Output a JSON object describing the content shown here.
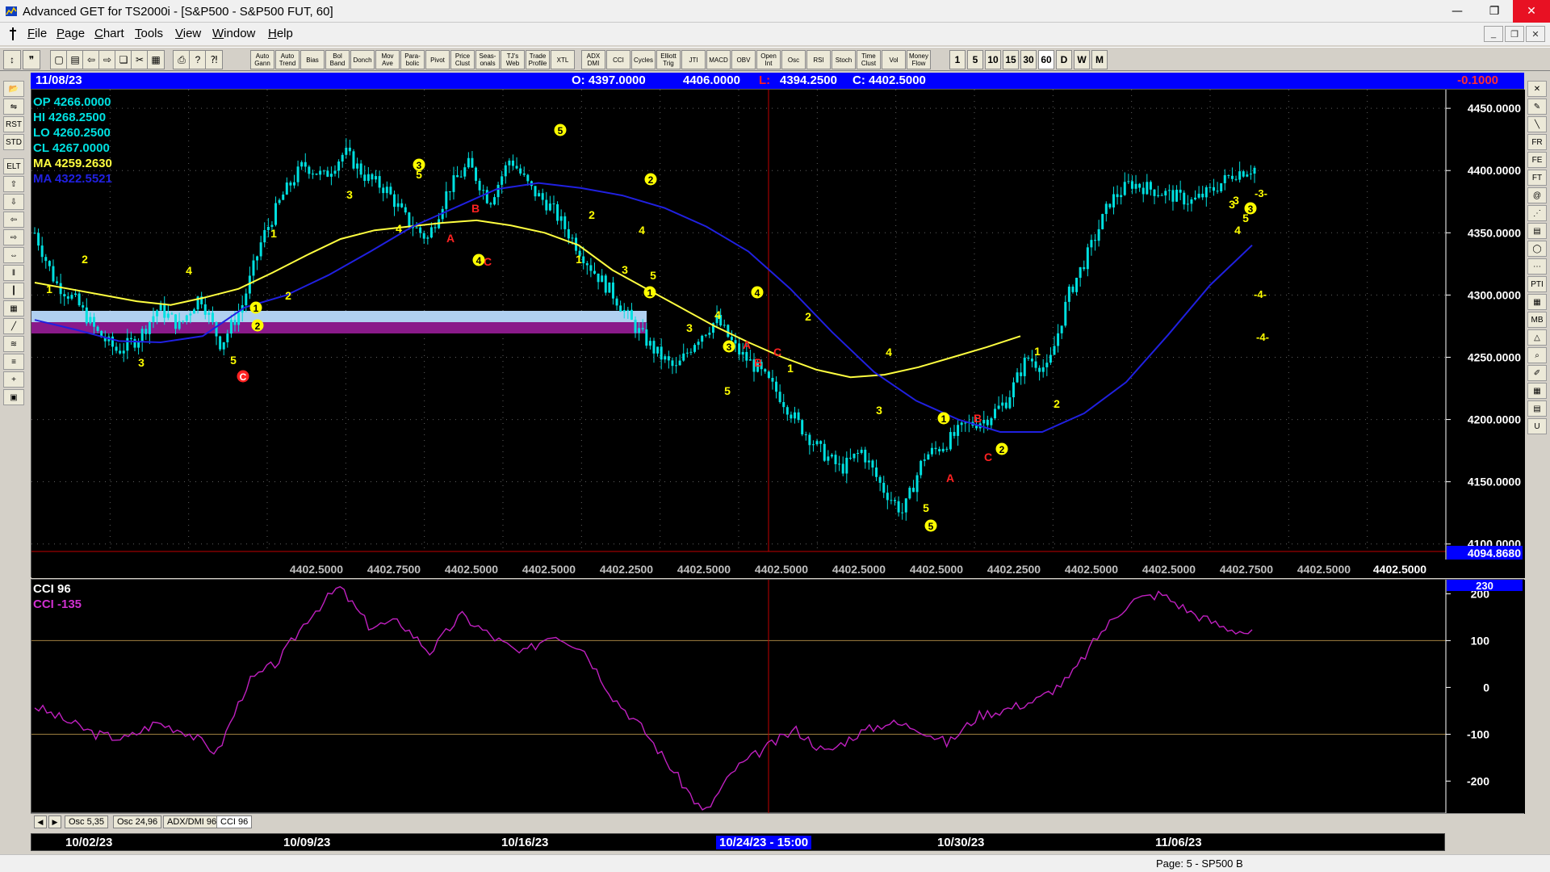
{
  "window": {
    "title": "Advanced GET for TS2000i - [S&P500 - S&P500 FUT, 60]",
    "controls": [
      "—",
      "❐",
      "✕"
    ]
  },
  "menu": [
    "File",
    "Page",
    "Chart",
    "Tools",
    "View",
    "Window",
    "Help"
  ],
  "toolbar": {
    "study_buttons": [
      "Auto Gann",
      "Auto Trend",
      "Bias",
      "Bol Band",
      "Donch",
      "Mov Ave",
      "Para-bolic",
      "Pivot",
      "Price Clust",
      "Seas-onals",
      "TJ's Web",
      "Trade Profile",
      "XTL",
      "ADX DMI",
      "CCI",
      "Cycles",
      "Elliott Trig",
      "JTI",
      "MACD",
      "OBV",
      "Open Int",
      "Osc",
      "RSI",
      "Stoch",
      "Time Clust",
      "Vol",
      "Money Flow"
    ],
    "periods": [
      "1",
      "5",
      "10",
      "15",
      "30",
      "60",
      "D",
      "W",
      "M"
    ],
    "active_period": "60"
  },
  "header": {
    "date": "11/08/23",
    "open": "O: 4397.0000",
    "high": "4406.0000",
    "low_prefix": "L:",
    "low": "4394.2500",
    "close": "C:  4402.5000",
    "change": "-0.1000"
  },
  "info": {
    "op": "OP  4266.0000",
    "hi": "HI   4268.2500",
    "lo": "LO  4260.2500",
    "cl": "CL  4267.0000",
    "ma1": "MA  4259.2630",
    "ma2": "MA  4322.5521"
  },
  "price_axis": {
    "labels": [
      "4450.0000",
      "4400.0000",
      "4350.0000",
      "4300.0000",
      "4250.0000",
      "4200.0000",
      "4150.0000",
      "4100.0000"
    ],
    "current_value": "4094.8680"
  },
  "bottom_strip": {
    "values": [
      "4402.5000",
      "4402.7500",
      "4402.5000",
      "4402.5000",
      "4402.2500",
      "4402.5000",
      "4402.5000",
      "4402.5000",
      "4402.5000",
      "4402.2500",
      "4402.5000",
      "4402.5000",
      "4402.7500",
      "4402.5000"
    ],
    "current": "4402.5000"
  },
  "cci": {
    "title": "CCI 96",
    "value": "CCI  -135",
    "axis_labels": [
      "200",
      "100",
      "0",
      "-100",
      "-200"
    ],
    "top_label": "230"
  },
  "tabs": [
    "Osc 5,35",
    "Osc 24,96",
    "ADX/DMI 96",
    "CCI 96"
  ],
  "active_tab": "CCI 96",
  "dates": [
    "10/02/23",
    "10/09/23",
    "10/16/23",
    "10/24/23 - 15:00",
    "10/30/23",
    "11/06/23"
  ],
  "cursor_date": "10/24/23 - 15:00",
  "status": "Page: 5 - SP500 B",
  "colors": {
    "candle": "#00e0e0",
    "ma_fast": "#ffff40",
    "ma_slow": "#2020e0",
    "cci": "#c020c0",
    "wave_label": "#ffff00",
    "abc_label": "#ff2020",
    "band_light": "#b0d0f0",
    "band_dark": "#8a1a8a"
  },
  "chart_data": {
    "type": "candlestick",
    "symbol": "S&P500 FUT",
    "interval": "60",
    "ylim": [
      4094,
      4465
    ],
    "x_labels": [
      "10/02/23",
      "10/09/23",
      "10/16/23",
      "10/24/23 - 15:00",
      "10/30/23",
      "11/06/23"
    ],
    "series": [
      {
        "name": "Close",
        "values": [
          4350,
          4310,
          4295,
          4270,
          4255,
          4265,
          4290,
          4275,
          4300,
          4260,
          4290,
          4345,
          4380,
          4405,
          4395,
          4415,
          4395,
          4385,
          4360,
          4345,
          4385,
          4405,
          4375,
          4410,
          4385,
          4370,
          4345,
          4320,
          4300,
          4275,
          4255,
          4240,
          4265,
          4280,
          4255,
          4240,
          4220,
          4195,
          4175,
          4160,
          4175,
          4145,
          4125,
          4170,
          4180,
          4195,
          4200,
          4215,
          4250,
          4240,
          4300,
          4335,
          4375,
          4390,
          4385,
          4380,
          4375,
          4385,
          4398,
          4402
        ]
      },
      {
        "name": "MA",
        "values": [
          4310,
          4305,
          4300,
          4295,
          4292,
          4298,
          4305,
          4318,
          4332,
          4345,
          4352,
          4355,
          4358,
          4360,
          4356,
          4350,
          4340,
          4320,
          4305,
          4290,
          4275,
          4262,
          4250,
          4240,
          4234,
          4236,
          4242,
          4250,
          4258,
          4267
        ]
      },
      {
        "name": "MA",
        "values": [
          4280,
          4272,
          4263,
          4262,
          4267,
          4290,
          4300,
          4316,
          4335,
          4355,
          4370,
          4385,
          4390,
          4386,
          4380,
          4370,
          4355,
          4335,
          4305,
          4270,
          4238,
          4215,
          4200,
          4190,
          4190,
          4205,
          4230,
          4268,
          4308,
          4340
        ]
      },
      {
        "name": "CCI 96",
        "values": [
          -40,
          -70,
          -100,
          -110,
          -75,
          -95,
          -140,
          10,
          55,
          150,
          215,
          130,
          140,
          75,
          155,
          110,
          70,
          115,
          85,
          -20,
          -90,
          -180,
          -270,
          -175,
          -130,
          -90,
          -140,
          -100,
          -75,
          -85,
          -120,
          -60,
          -45,
          -25,
          20,
          115,
          185,
          200,
          160,
          130,
          115
        ]
      }
    ],
    "cci_ylim": [
      -270,
      230
    ]
  }
}
